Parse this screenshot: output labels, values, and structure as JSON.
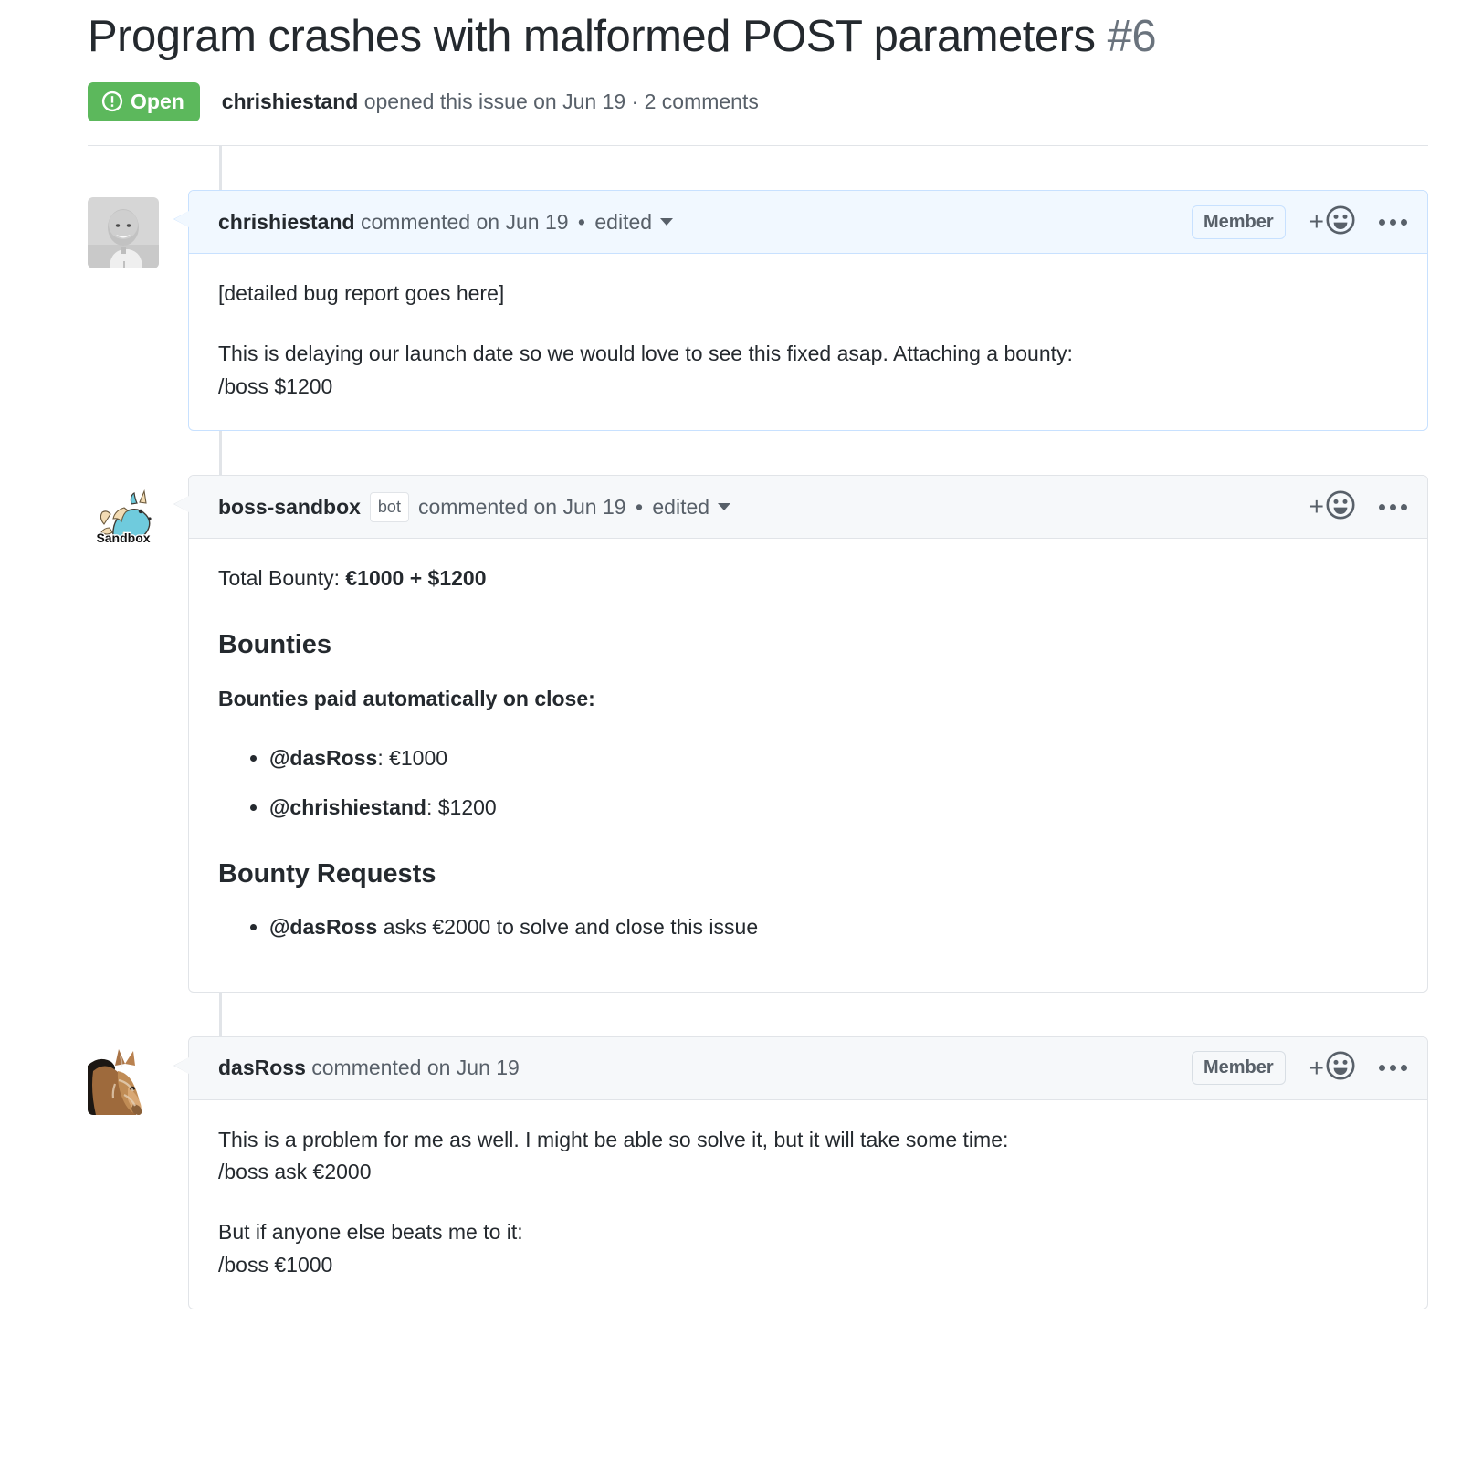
{
  "issue": {
    "title": "Program crashes with malformed POST parameters",
    "number": "#6",
    "state_label": "Open",
    "state_icon": "issue-opened-icon",
    "state_color": "#5cb85c",
    "meta_author": "chrishiestand",
    "meta_rest": " opened this issue on Jun 19 · 2 comments"
  },
  "comments": [
    {
      "id": "comment-chrishiestand",
      "author": "chrishiestand",
      "avatar": "avatar-person-photo",
      "action": "commented on Jun 19",
      "separator": "•",
      "edited": "edited",
      "role_badge": "Member",
      "has_role_badge": true,
      "is_bot": false,
      "bot_tag": "",
      "highlight": true,
      "body": {
        "p1": "[detailed bug report goes here]",
        "p2_line1": "This is delaying our launch date so we would love to see this fixed asap. Attaching a bounty:",
        "p2_line2": "/boss $1200"
      }
    },
    {
      "id": "comment-boss-sandbox",
      "author": "boss-sandbox",
      "avatar": "avatar-unicorn-sandbox",
      "action": "commented on Jun 19",
      "separator": "•",
      "edited": "edited",
      "role_badge": "",
      "has_role_badge": false,
      "is_bot": true,
      "bot_tag": "bot",
      "highlight": false,
      "body": {
        "total_label": "Total Bounty: ",
        "total_value": "€1000 + $1200",
        "heading_bounties": "Bounties",
        "paid_label": "Bounties paid automatically on close:",
        "paid_items": [
          {
            "user": "@dasRoss",
            "amount": ": €1000"
          },
          {
            "user": "@chrishiestand",
            "amount": ": $1200"
          }
        ],
        "heading_requests": "Bounty Requests",
        "request_items": [
          {
            "user": "@dasRoss",
            "amount": " asks €2000 to solve and close this issue"
          }
        ]
      }
    },
    {
      "id": "comment-dasross",
      "author": "dasRoss",
      "avatar": "avatar-horse-photo",
      "action": "commented on Jun 19",
      "separator": "",
      "edited": "",
      "role_badge": "Member",
      "has_role_badge": true,
      "is_bot": false,
      "bot_tag": "",
      "highlight": false,
      "body": {
        "p1_line1": "This is a problem for me as well. I might be able so solve it, but it will take some time:",
        "p1_line2": "/boss ask €2000",
        "p2_line1": "But if anyone else beats me to it:",
        "p2_line2": "/boss €1000"
      }
    }
  ],
  "icons": {
    "reaction": "smiley-icon",
    "plus": "+",
    "overflow": "kebab-horizontal-icon",
    "caret": "chevron-down-icon"
  },
  "sandbox_avatar_label": "Sandbox"
}
